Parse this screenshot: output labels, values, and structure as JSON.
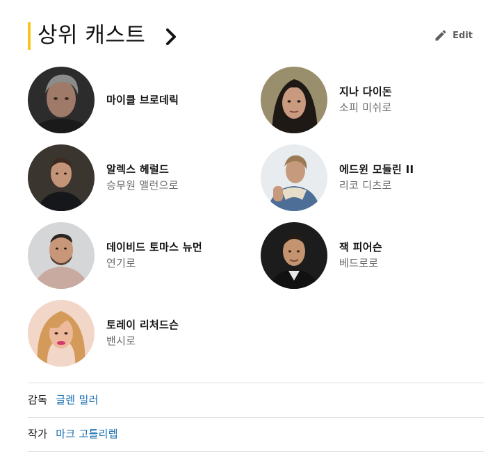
{
  "section": {
    "title": "상위 캐스트",
    "edit_label": "Edit",
    "accent_color": "#f5c518"
  },
  "cast": [
    {
      "name": "마이클 브로데릭",
      "role": ""
    },
    {
      "name": "지나 다이돈",
      "role": "소피 미쉬로"
    },
    {
      "name": "알렉스 헤럴드",
      "role": "승무원 앨런으로"
    },
    {
      "name": "에드윈 모들린 II",
      "role": "리코 디츠로"
    },
    {
      "name": "데이비드 토마스 뉴먼",
      "role": "연기로"
    },
    {
      "name": "잭 피어슨",
      "role": "베드로로"
    },
    {
      "name": "토레이 리처드슨",
      "role": "밴시로"
    }
  ],
  "credits": [
    {
      "label": "감독",
      "value": "글렌 밀러"
    },
    {
      "label": "작가",
      "value": "마크 고틀리렙"
    }
  ],
  "link_color": "#136cb2"
}
